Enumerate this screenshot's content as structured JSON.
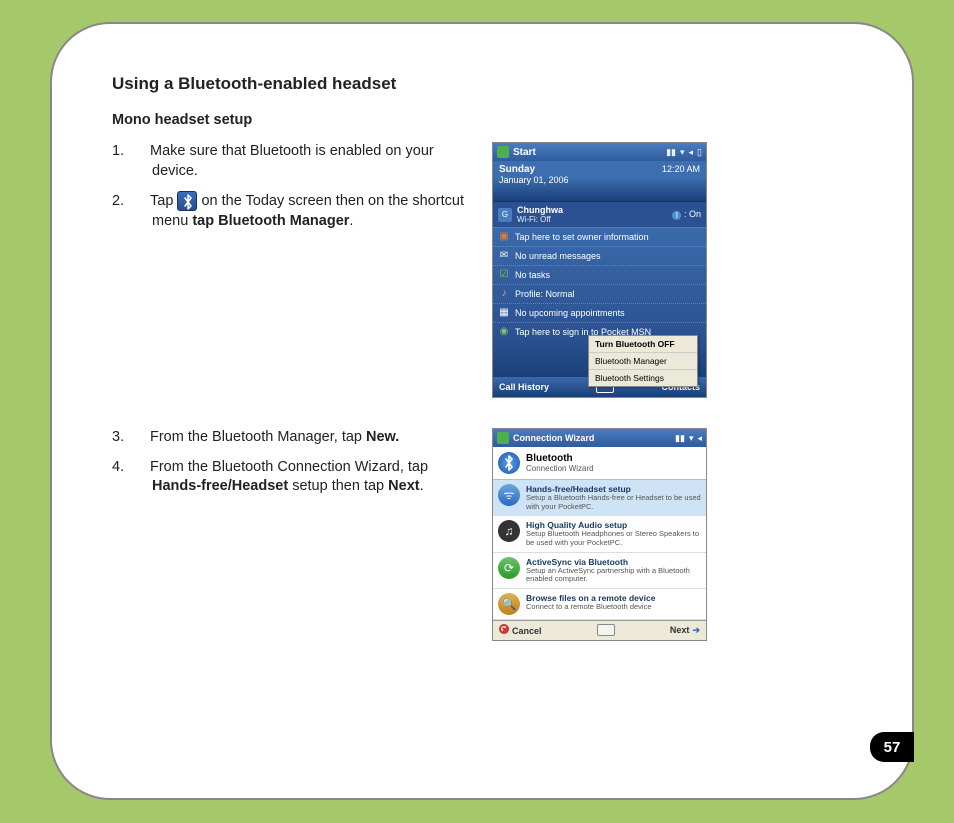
{
  "page": {
    "number": "57",
    "heading": "Using a Bluetooth-enabled headset",
    "subheading": "Mono headset setup"
  },
  "steps_a": {
    "s1_num": "1.",
    "s1_text": "Make sure that Bluetooth is enabled on your device.",
    "s2_num": "2.",
    "s2_pre": "Tap ",
    "s2_mid": " on the Today screen then on the shortcut menu ",
    "s2_bold": "tap Bluetooth Manager",
    "s2_post": "."
  },
  "steps_b": {
    "s3_num": "3.",
    "s3_pre": "From the Bluetooth Manager, tap ",
    "s3_bold": "New.",
    "s4_num": "4.",
    "s4_pre": "From the Bluetooth Connection Wizard, tap ",
    "s4_bold1": "Hands-free/Headset",
    "s4_mid": " setup then tap ",
    "s4_bold2": "Next",
    "s4_post": "."
  },
  "shot1": {
    "title": "Start",
    "time": "12:20 AM",
    "day": "Sunday",
    "date": "January 01, 2006",
    "carrier": "Chunghwa",
    "wifi": "Wi-Fi: Off",
    "bt_state": "On",
    "items": [
      "Tap here to set owner information",
      "No unread messages",
      "No tasks",
      "Profile: Normal",
      "No upcoming appointments",
      "Tap here to sign in to Pocket MSN"
    ],
    "popup": {
      "opt1": "Turn Bluetooth OFF",
      "opt2": "Bluetooth Manager",
      "opt3": "Bluetooth Settings"
    },
    "soft_left": "Call History",
    "soft_right": "Contacts"
  },
  "shot2": {
    "title": "Connection Wizard",
    "header_title": "Bluetooth",
    "header_sub": "Connection Wizard",
    "options": [
      {
        "title": "Hands-free/Headset setup",
        "desc": "Setup a Bluetooth Hands-free or Headset to be used with your PocketPC."
      },
      {
        "title": "High Quality Audio setup",
        "desc": "Setup Bluetooth Headphones or Stereo Speakers to be used with your PocketPC."
      },
      {
        "title": "ActiveSync via Bluetooth",
        "desc": "Setup an ActiveSync partnership with a Bluetooth enabled computer."
      },
      {
        "title": "Browse files on a remote device",
        "desc": "Connect to a remote Bluetooth device"
      }
    ],
    "soft_left": "Cancel",
    "soft_right": "Next"
  }
}
